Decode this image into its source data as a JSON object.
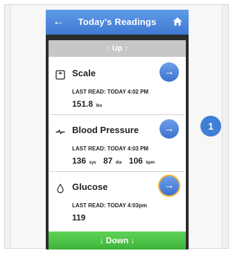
{
  "header": {
    "back_icon": "back-arrow-icon",
    "title": "Today's Readings",
    "home_icon": "home-icon"
  },
  "nav": {
    "up_label": "↑ Up ↑",
    "down_label": "↓ Down ↓"
  },
  "readings": [
    {
      "name": "Scale",
      "icon": "scale-icon",
      "last_read": "LAST READ:  TODAY 4:02 PM",
      "values": [
        {
          "value": "151.8",
          "unit": "lbs"
        }
      ]
    },
    {
      "name": "Blood Pressure",
      "icon": "heartbeat-icon",
      "last_read": "LAST READ:  TODAY 4:03 PM",
      "values": [
        {
          "value": "136",
          "unit": "sys"
        },
        {
          "value": "87",
          "unit": "dia"
        },
        {
          "value": "106",
          "unit": "bpm"
        }
      ]
    },
    {
      "name": "Glucose",
      "icon": "droplet-icon",
      "last_read": "LAST READ:  TODAY 4:03pm",
      "values": [
        {
          "value": "119",
          "unit": ""
        }
      ]
    }
  ],
  "callout_badge": "1",
  "colors": {
    "header_blue": "#4a85dc",
    "arrow_blue": "#3b72cf",
    "down_green": "#45bb3f",
    "highlight_ring": "#f0b429"
  }
}
